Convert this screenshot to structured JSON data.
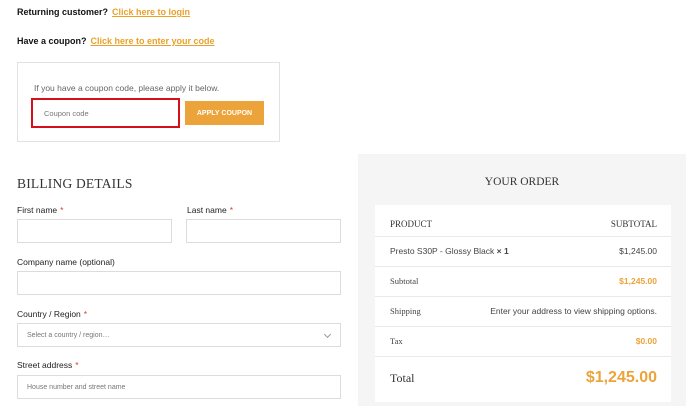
{
  "notices": {
    "returning_prefix": "Returning customer?",
    "returning_link": "Click here to login",
    "coupon_prefix": "Have a coupon?",
    "coupon_link": "Click here to enter your code"
  },
  "coupon": {
    "description": "If you have a coupon code, please apply it below.",
    "placeholder": "Coupon code",
    "button": "APPLY COUPON"
  },
  "billing": {
    "title": "BILLING DETAILS",
    "required_mark": "*",
    "first_name": "First name",
    "last_name": "Last name",
    "company": "Company name (optional)",
    "country": "Country / Region",
    "country_placeholder": "Select a country / region…",
    "street": "Street address",
    "street_placeholder": "House number and street name"
  },
  "order": {
    "title": "YOUR ORDER",
    "col_product": "PRODUCT",
    "col_subtotal": "SUBTOTAL",
    "item_name": "Presto S30P - Glossy Black",
    "item_qty": "× 1",
    "item_price": "$1,245.00",
    "subtotal_label": "Subtotal",
    "subtotal_value": "$1,245.00",
    "shipping_label": "Shipping",
    "shipping_value": "Enter your address to view shipping options.",
    "tax_label": "Tax",
    "tax_value": "$0.00",
    "total_label": "Total",
    "total_value": "$1,245.00"
  },
  "colors": {
    "accent": "#eca33a",
    "required": "#d43c33",
    "highlight_border": "#d6101b"
  }
}
